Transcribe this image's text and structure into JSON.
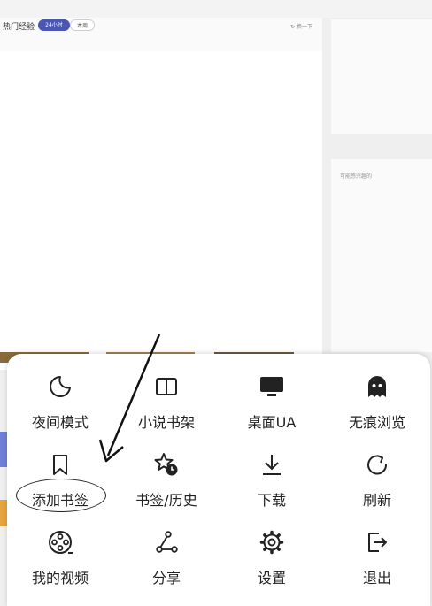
{
  "background": {
    "hot_title": "热门经验",
    "tab_active": "24小时",
    "tab_inactive": "本周",
    "refresh_link": "换一下",
    "side_label": "可能感兴趣的"
  },
  "menu": {
    "items": [
      {
        "label": "夜间模式",
        "icon": "moon-icon"
      },
      {
        "label": "小说书架",
        "icon": "book-icon"
      },
      {
        "label": "桌面UA",
        "icon": "monitor-icon"
      },
      {
        "label": "无痕浏览",
        "icon": "ghost-icon"
      },
      {
        "label": "添加书签",
        "icon": "bookmark-icon"
      },
      {
        "label": "书签/历史",
        "icon": "star-history-icon"
      },
      {
        "label": "下载",
        "icon": "download-icon"
      },
      {
        "label": "刷新",
        "icon": "refresh-icon"
      },
      {
        "label": "我的视频",
        "icon": "film-reel-icon"
      },
      {
        "label": "分享",
        "icon": "share-icon"
      },
      {
        "label": "设置",
        "icon": "settings-gear-icon"
      },
      {
        "label": "退出",
        "icon": "exit-icon"
      }
    ]
  },
  "colors": {
    "accent": "#4b55b2",
    "text": "#222222"
  }
}
